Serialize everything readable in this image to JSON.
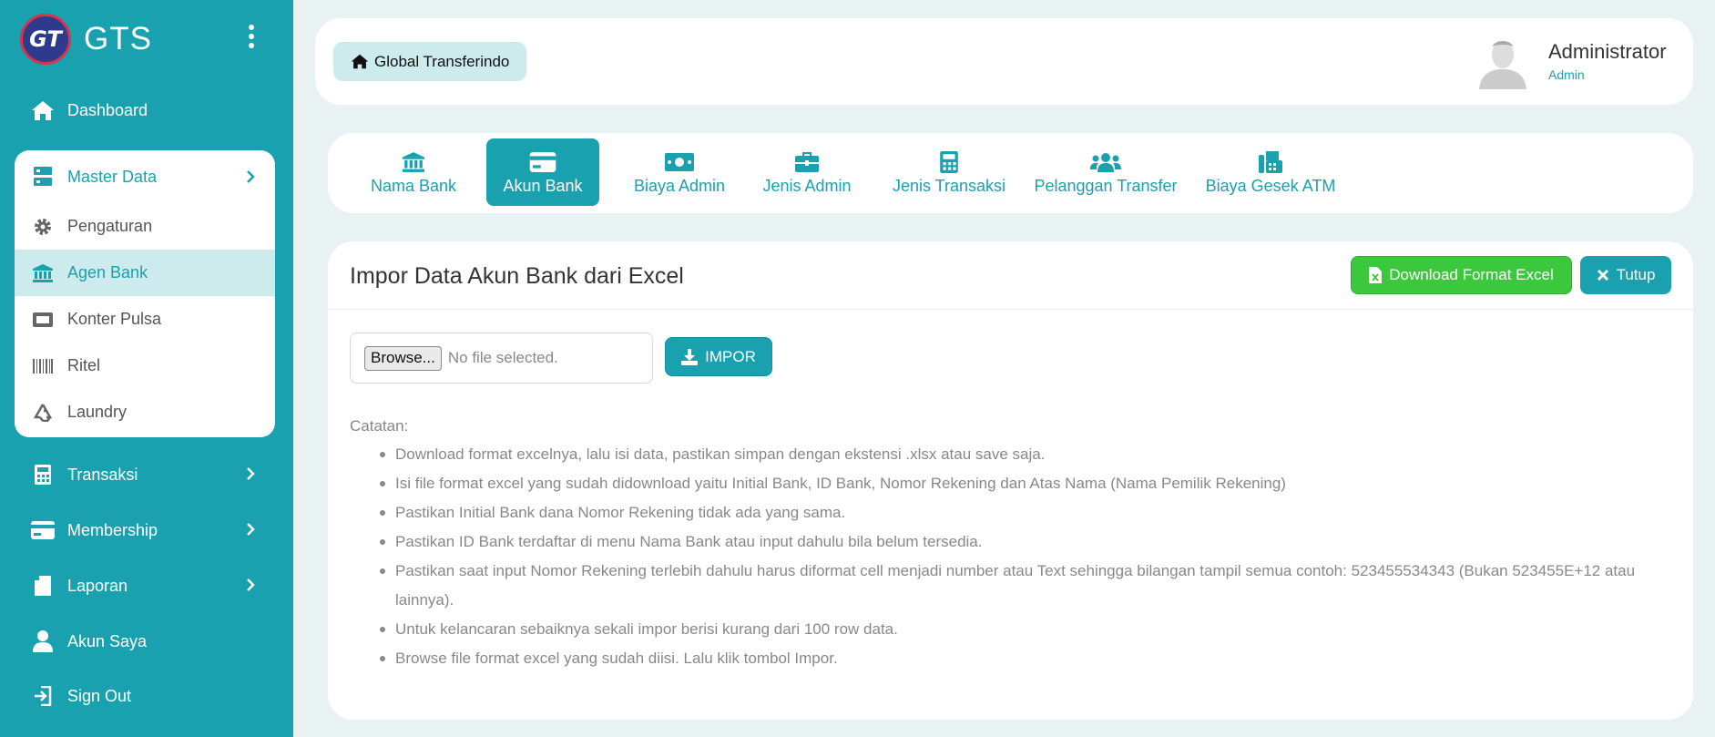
{
  "brand": {
    "logo_text": "GT",
    "name": "GTS"
  },
  "sidebar": {
    "dashboard": "Dashboard",
    "master": {
      "label": "Master Data",
      "items": [
        {
          "label": "Pengaturan",
          "icon": "gear-icon"
        },
        {
          "label": "Agen Bank",
          "icon": "bank-icon",
          "active": true
        },
        {
          "label": "Konter Pulsa",
          "icon": "ticket-icon"
        },
        {
          "label": "Ritel",
          "icon": "barcode-icon"
        },
        {
          "label": "Laundry",
          "icon": "recycle-icon"
        }
      ]
    },
    "transaksi": "Transaksi",
    "membership": "Membership",
    "laporan": "Laporan",
    "akun": "Akun Saya",
    "signout": "Sign Out"
  },
  "header": {
    "breadcrumb": "Global Transferindo",
    "user_name": "Administrator",
    "user_role": "Admin"
  },
  "tabs": [
    {
      "label": "Nama Bank",
      "icon": "bank-icon"
    },
    {
      "label": "Akun Bank",
      "icon": "credit-card-icon",
      "active": true
    },
    {
      "label": "Biaya Admin",
      "icon": "money-bill-icon"
    },
    {
      "label": "Jenis Admin",
      "icon": "briefcase-icon"
    },
    {
      "label": "Jenis Transaksi",
      "icon": "calculator-icon"
    },
    {
      "label": "Pelanggan Transfer",
      "icon": "users-icon"
    },
    {
      "label": "Biaya Gesek ATM",
      "icon": "fax-icon"
    }
  ],
  "card": {
    "title": "Impor Data Akun Bank dari Excel",
    "download_label": "Download Format Excel",
    "close_label": "Tutup",
    "browse_label": "Browse...",
    "file_status": "No file selected.",
    "import_label": "IMPOR",
    "notes_title": "Catatan:",
    "notes": [
      "Download format excelnya, lalu isi data, pastikan simpan dengan ekstensi .xlsx atau save saja.",
      "Isi file format excel yang sudah didownload yaitu Initial Bank, ID Bank, Nomor Rekening dan Atas Nama (Nama Pemilik Rekening)",
      "Pastikan Initial Bank dana Nomor Rekening tidak ada yang sama.",
      "Pastikan ID Bank terdaftar di menu Nama Bank atau input dahulu bila belum tersedia.",
      "Pastikan saat input Nomor Rekening terlebih dahulu harus diformat cell menjadi number atau Text sehingga bilangan tampil semua contoh: 523455534343 (Bukan 523455E+12 atau lainnya).",
      "Untuk kelancaran sebaiknya sekali impor berisi kurang dari 100 row data.",
      "Browse file format excel yang sudah diisi. Lalu klik tombol Impor."
    ]
  },
  "colors": {
    "primary": "#1aa1b0",
    "success": "#3cc83c",
    "active_bg": "#cdeaed"
  }
}
